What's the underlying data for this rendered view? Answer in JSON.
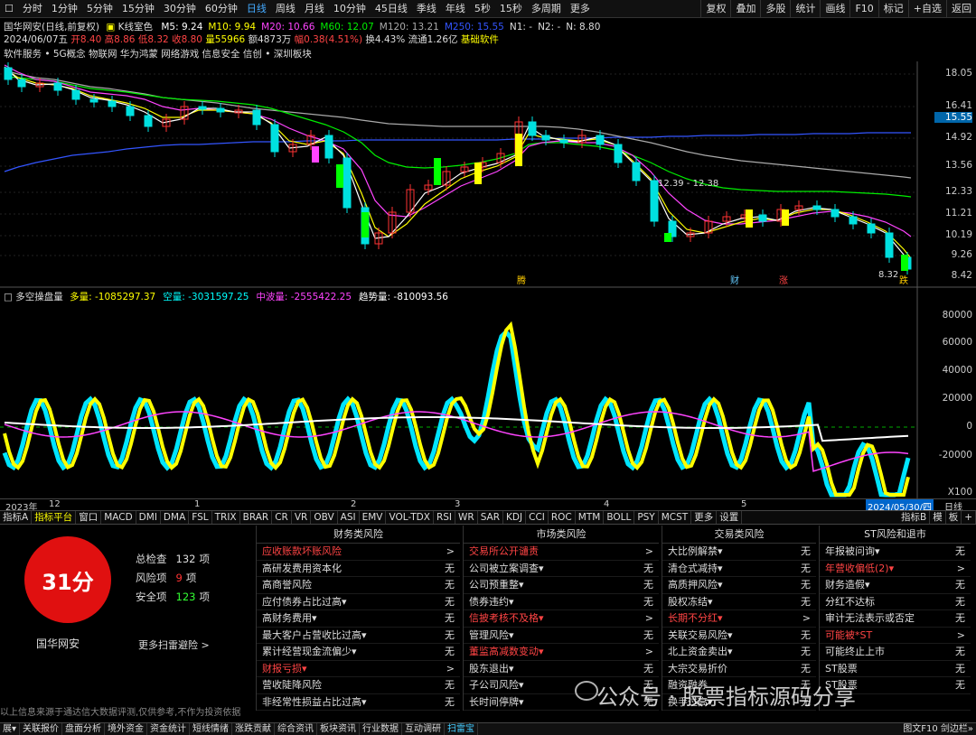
{
  "topbar": {
    "periods": [
      "分时",
      "1分钟",
      "5分钟",
      "15分钟",
      "30分钟",
      "60分钟",
      "日线",
      "周线",
      "月线",
      "10分钟",
      "45日线",
      "季线",
      "年线",
      "5秒",
      "15秒",
      "多周期",
      "更多"
    ],
    "active": "日线",
    "right": [
      "复权",
      "叠加",
      "多股",
      "统计",
      "画线",
      "F10",
      "标记",
      "+自选",
      "返回"
    ]
  },
  "main": {
    "title": "国华网安(日线,前复权)",
    "mode": "K线室色",
    "ma": [
      {
        "label": "M5: 9.24",
        "color": "#ffffff"
      },
      {
        "label": "M10: 9.94",
        "color": "#ffff00"
      },
      {
        "label": "M20: 10.66",
        "color": "#ff44ff"
      },
      {
        "label": "M60: 12.07",
        "color": "#00ee00"
      },
      {
        "label": "M120: 13.21",
        "color": "#aaaaaa"
      },
      {
        "label": "M250: 15.55",
        "color": "#3355ff"
      },
      {
        "label": "N1: -",
        "color": "#dddddd"
      },
      {
        "label": "N2: -",
        "color": "#dddddd"
      },
      {
        "label": "N: 8.80",
        "color": "#dddddd"
      }
    ],
    "ohlc": {
      "date": "2024/06/07五",
      "open": "开8.40",
      "high": "高8.86",
      "low": "低8.32",
      "close": "收8.80",
      "vol": "量55966",
      "amt": "额4873万",
      "chg": "幅0.38(4.51%)",
      "turn": "换4.43%",
      "float": "流通1.26亿",
      "sector": "基础软件"
    },
    "concepts": "软件服务 • 5G概念 物联网 华为鸿蒙 网络游戏 信息安全 信创 • 深圳板块",
    "yaxis": [
      "18.05",
      "16.41",
      "15.55",
      "14.92",
      "13.56",
      "12.33",
      "11.21",
      "10.19",
      "9.26",
      "8.42"
    ],
    "annot_range": "12.39 - 12.38",
    "annot_low": "8.32",
    "events": [
      "腾",
      "财",
      "涨",
      "跌"
    ]
  },
  "sub": {
    "title": "多空操盘量",
    "items": [
      {
        "label": "多量: -1085297.37",
        "color": "#ffff00"
      },
      {
        "label": "空量: -3031597.25",
        "color": "#00ffff"
      },
      {
        "label": "中波量: -2555422.25",
        "color": "#ff44ff"
      },
      {
        "label": "趋势量: -810093.56",
        "color": "#ffffff"
      }
    ],
    "yaxis": [
      "80000",
      "60000",
      "40000",
      "20000",
      "0",
      "-20000",
      "X100"
    ]
  },
  "xaxis": {
    "labels": [
      "2023年",
      "12",
      "1",
      "2",
      "3",
      "4",
      "5"
    ],
    "date": "2024/05/30/四",
    "period": "日线"
  },
  "indbar": {
    "items": [
      "指标A",
      "指标平台",
      "窗口",
      "MACD",
      "DMI",
      "DMA",
      "FSL",
      "TRIX",
      "BRAR",
      "CR",
      "VR",
      "OBV",
      "ASI",
      "EMV",
      "VOL-TDX",
      "RSI",
      "WR",
      "SAR",
      "KDJ",
      "CCI",
      "ROC",
      "MTM",
      "BOLL",
      "PSY",
      "MCST",
      "更多",
      "设置"
    ],
    "right": [
      "指标B",
      "模",
      "板",
      "+"
    ]
  },
  "score": {
    "value": "31分",
    "name": "国华网安",
    "stats": [
      {
        "label": "总检查",
        "value": "132",
        "unit": "项",
        "color": "#ddd"
      },
      {
        "label": "风险项",
        "value": "9",
        "unit": "项",
        "color": "#f33"
      },
      {
        "label": "安全项",
        "value": "123",
        "unit": "项",
        "color": "#3f3"
      }
    ],
    "more": "更多扫雷避险 >",
    "disclaimer": "以上信息来源于通达信大数据评测,仅供参考,不作为投资依据"
  },
  "columns": [
    {
      "title": "财务类风险",
      "rows": [
        {
          "n": "应收账款坏账风险",
          "v": ">",
          "r": true
        },
        {
          "n": "高研发费用资本化",
          "v": "无"
        },
        {
          "n": "高商誉风险",
          "v": "无"
        },
        {
          "n": "应付债券占比过高▾",
          "v": "无"
        },
        {
          "n": "高财务费用▾",
          "v": "无"
        },
        {
          "n": "最大客户占营收比过高▾",
          "v": "无"
        },
        {
          "n": "累计经营现金流偏少▾",
          "v": "无"
        },
        {
          "n": "财报亏损▾",
          "v": ">",
          "r": true
        },
        {
          "n": "营收陡降风险",
          "v": "无"
        },
        {
          "n": "非经常性损益占比过高▾",
          "v": "无"
        }
      ]
    },
    {
      "title": "市场类风险",
      "rows": [
        {
          "n": "交易所公开谴责",
          "v": ">",
          "r": true
        },
        {
          "n": "公司被立案调查▾",
          "v": "无"
        },
        {
          "n": "公司预重整▾",
          "v": "无"
        },
        {
          "n": "债券违约▾",
          "v": "无"
        },
        {
          "n": "信披考核不及格▾",
          "v": ">",
          "r": true
        },
        {
          "n": "管理风险▾",
          "v": "无"
        },
        {
          "n": "董监高减数变动▾",
          "v": ">",
          "r": true
        },
        {
          "n": "股东退出▾",
          "v": "无"
        },
        {
          "n": "子公司风险▾",
          "v": "无"
        },
        {
          "n": "长时间停牌▾",
          "v": "无"
        }
      ]
    },
    {
      "title": "交易类风险",
      "rows": [
        {
          "n": "大比例解禁▾",
          "v": "无"
        },
        {
          "n": "清仓式减持▾",
          "v": "无"
        },
        {
          "n": "高质押风险▾",
          "v": "无"
        },
        {
          "n": "股权冻结▾",
          "v": "无"
        },
        {
          "n": "长期不分红▾",
          "v": ">",
          "r": true
        },
        {
          "n": "关联交易风险▾",
          "v": "无"
        },
        {
          "n": "北上资金卖出▾",
          "v": "无"
        },
        {
          "n": "大宗交易折价",
          "v": "无"
        },
        {
          "n": "融资融券",
          "v": "无"
        },
        {
          "n": "换手过高▾",
          "v": "无"
        }
      ]
    },
    {
      "title": "ST风险和退市",
      "rows": [
        {
          "n": "年报被问询▾",
          "v": "无"
        },
        {
          "n": "年营收偏低(2)▾",
          "v": ">",
          "r": true
        },
        {
          "n": "财务造假▾",
          "v": "无"
        },
        {
          "n": "分红不达标",
          "v": "无"
        },
        {
          "n": "审计无法表示或否定",
          "v": "无"
        },
        {
          "n": "可能被*ST",
          "v": ">",
          "r": true
        },
        {
          "n": "可能终止上市",
          "v": "无"
        },
        {
          "n": "ST股票",
          "v": "无"
        },
        {
          "n": "ST股票",
          "v": "无"
        },
        {
          "n": "",
          "v": ""
        }
      ]
    }
  ],
  "bottombar": {
    "items": [
      "展▾",
      "关联报价",
      "盘面分析",
      "境外资金",
      "资金统计",
      "短线情绪",
      "涨跌贡献",
      "综合资讯",
      "板块资讯",
      "行业数据",
      "互动调研",
      "扫雷宝"
    ],
    "active": "扫雷宝",
    "right": "图文F10 剑边栏»"
  },
  "watermark": "公众号 · 股票指标源码分享"
}
